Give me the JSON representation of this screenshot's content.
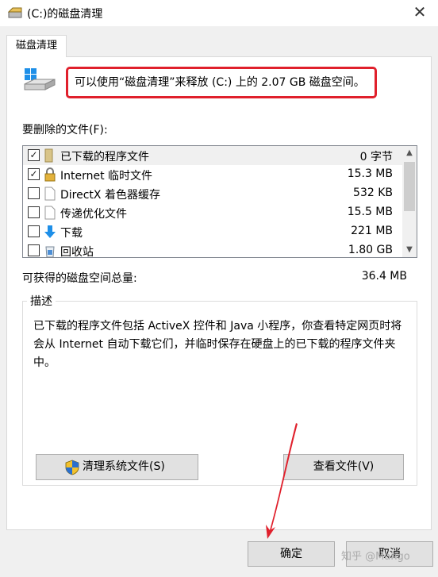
{
  "window": {
    "title": "(C:)的磁盘清理"
  },
  "tab": {
    "label": "磁盘清理"
  },
  "summary": {
    "text": "可以使用“磁盘清理”来释放 (C:) 上的 2.07 GB 磁盘空间。"
  },
  "files": {
    "label": "要删除的文件(F):",
    "items": [
      {
        "name": "已下载的程序文件",
        "size": "0 字节",
        "checked": true,
        "icon": "folder-icon"
      },
      {
        "name": "Internet 临时文件",
        "size": "15.3 MB",
        "checked": true,
        "icon": "lock-icon"
      },
      {
        "name": "DirectX 着色器缓存",
        "size": "532 KB",
        "checked": false,
        "icon": "file-icon"
      },
      {
        "name": "传递优化文件",
        "size": "15.5 MB",
        "checked": false,
        "icon": "file-icon"
      },
      {
        "name": "下载",
        "size": "221 MB",
        "checked": false,
        "icon": "download-arrow-icon"
      },
      {
        "name": "回收站",
        "size": "1.80 GB",
        "checked": false,
        "icon": "recycle-bin-icon"
      }
    ]
  },
  "total": {
    "label": "可获得的磁盘空间总量:",
    "value": "36.4 MB"
  },
  "description": {
    "legend": "描述",
    "text": "已下载的程序文件包括 ActiveX 控件和 Java 小程序，你查看特定网页时将会从 Internet 自动下载它们，并临时保存在硬盘上的已下载的程序文件夹中。"
  },
  "buttons": {
    "clean_system": "清理系统文件(S)",
    "view_files": "查看文件(V)",
    "ok": "确定",
    "cancel": "取消"
  },
  "watermark": "知乎 @Mango",
  "colors": {
    "highlight_box": "#e0202c",
    "arrow": "#e0202c"
  }
}
